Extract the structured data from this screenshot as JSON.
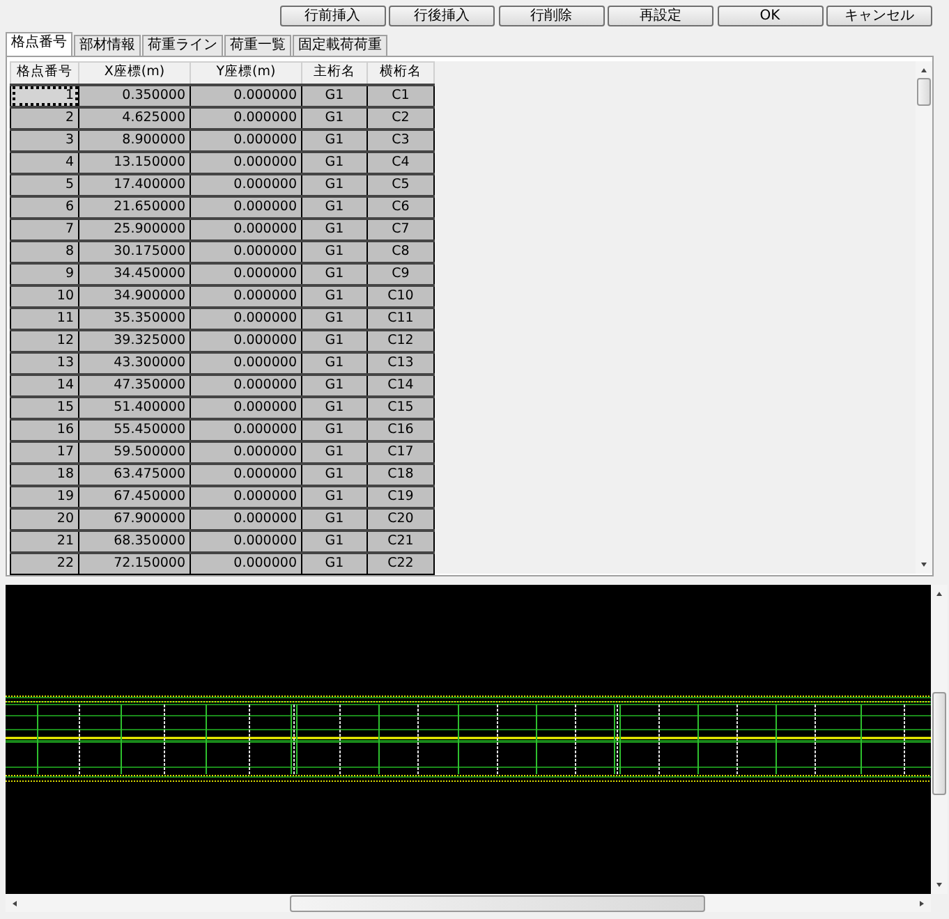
{
  "buttons": [
    "行前挿入",
    "行後挿入",
    "行削除",
    "再設定",
    "OK",
    "キャンセル"
  ],
  "tabs": [
    {
      "label": "格点番号",
      "selected": true
    },
    {
      "label": "部材情報",
      "selected": false
    },
    {
      "label": "荷重ライン",
      "selected": false
    },
    {
      "label": "荷重一覧",
      "selected": false
    },
    {
      "label": "固定載荷荷重",
      "selected": false
    }
  ],
  "table": {
    "columns": [
      "格点番号",
      "X座標(m)",
      "Y座標(m)",
      "主桁名",
      "横桁名"
    ],
    "rows": [
      {
        "cells": [
          "1",
          "0.350000",
          "0.000000",
          "G1",
          "C1"
        ],
        "focused": true
      },
      {
        "cells": [
          "2",
          "4.625000",
          "0.000000",
          "G1",
          "C2"
        ],
        "focused": false
      },
      {
        "cells": [
          "3",
          "8.900000",
          "0.000000",
          "G1",
          "C3"
        ],
        "focused": false
      },
      {
        "cells": [
          "4",
          "13.150000",
          "0.000000",
          "G1",
          "C4"
        ],
        "focused": false
      },
      {
        "cells": [
          "5",
          "17.400000",
          "0.000000",
          "G1",
          "C5"
        ],
        "focused": false
      },
      {
        "cells": [
          "6",
          "21.650000",
          "0.000000",
          "G1",
          "C6"
        ],
        "focused": false
      },
      {
        "cells": [
          "7",
          "25.900000",
          "0.000000",
          "G1",
          "C7"
        ],
        "focused": false
      },
      {
        "cells": [
          "8",
          "30.175000",
          "0.000000",
          "G1",
          "C8"
        ],
        "focused": false
      },
      {
        "cells": [
          "9",
          "34.450000",
          "0.000000",
          "G1",
          "C9"
        ],
        "focused": false
      },
      {
        "cells": [
          "10",
          "34.900000",
          "0.000000",
          "G1",
          "C10"
        ],
        "focused": false
      },
      {
        "cells": [
          "11",
          "35.350000",
          "0.000000",
          "G1",
          "C11"
        ],
        "focused": false
      },
      {
        "cells": [
          "12",
          "39.325000",
          "0.000000",
          "G1",
          "C12"
        ],
        "focused": false
      },
      {
        "cells": [
          "13",
          "43.300000",
          "0.000000",
          "G1",
          "C13"
        ],
        "focused": false
      },
      {
        "cells": [
          "14",
          "47.350000",
          "0.000000",
          "G1",
          "C14"
        ],
        "focused": false
      },
      {
        "cells": [
          "15",
          "51.400000",
          "0.000000",
          "G1",
          "C15"
        ],
        "focused": false
      },
      {
        "cells": [
          "16",
          "55.450000",
          "0.000000",
          "G1",
          "C16"
        ],
        "focused": false
      },
      {
        "cells": [
          "17",
          "59.500000",
          "0.000000",
          "G1",
          "C17"
        ],
        "focused": false
      },
      {
        "cells": [
          "18",
          "63.475000",
          "0.000000",
          "G1",
          "C18"
        ],
        "focused": false
      },
      {
        "cells": [
          "19",
          "67.450000",
          "0.000000",
          "G1",
          "C19"
        ],
        "focused": false
      },
      {
        "cells": [
          "20",
          "67.900000",
          "0.000000",
          "G1",
          "C20"
        ],
        "focused": false
      },
      {
        "cells": [
          "21",
          "68.350000",
          "0.000000",
          "G1",
          "C21"
        ],
        "focused": false
      },
      {
        "cells": [
          "22",
          "72.150000",
          "0.000000",
          "G1",
          "C22"
        ],
        "focused": false
      }
    ]
  }
}
